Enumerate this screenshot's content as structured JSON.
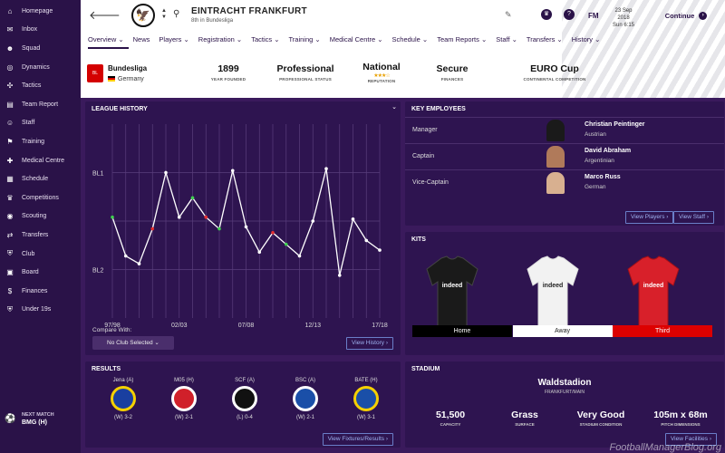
{
  "sidebar": {
    "items": [
      {
        "icon": "⌂",
        "label": "Homepage"
      },
      {
        "icon": "✉",
        "label": "Inbox"
      },
      {
        "icon": "☻",
        "label": "Squad"
      },
      {
        "icon": "◎",
        "label": "Dynamics"
      },
      {
        "icon": "✣",
        "label": "Tactics"
      },
      {
        "icon": "▤",
        "label": "Team Report"
      },
      {
        "icon": "☺",
        "label": "Staff"
      },
      {
        "icon": "⚑",
        "label": "Training"
      },
      {
        "icon": "✚",
        "label": "Medical Centre"
      },
      {
        "icon": "▦",
        "label": "Schedule"
      },
      {
        "icon": "♛",
        "label": "Competitions"
      },
      {
        "icon": "◉",
        "label": "Scouting"
      },
      {
        "icon": "⇄",
        "label": "Transfers"
      },
      {
        "icon": "⛨",
        "label": "Club"
      },
      {
        "icon": "▣",
        "label": "Board"
      },
      {
        "icon": "$",
        "label": "Finances"
      },
      {
        "icon": "⛨",
        "label": "Under 19s"
      }
    ],
    "next_match_label": "NEXT MATCH",
    "next_match_value": "BMG (H)"
  },
  "header": {
    "club_name": "EINTRACHT FRANKFURT",
    "club_sub": "8th in Bundesliga",
    "manager_initials": "FM",
    "date": "23 Sep 2018",
    "time": "Sun 6:15",
    "continue_label": "Continue"
  },
  "tabs": [
    "Overview",
    "News",
    "Players",
    "Registration",
    "Tactics",
    "Training",
    "Medical Centre",
    "Schedule",
    "Team Reports",
    "Staff",
    "Transfers",
    "History"
  ],
  "club_info": {
    "league": "Bundesliga",
    "country": "Germany",
    "bl_logo": "BL",
    "year_founded": "1899",
    "year_founded_label": "YEAR FOUNDED",
    "status": "Professional",
    "status_label": "PROFESSIONAL STATUS",
    "reputation": "National",
    "reputation_label": "REPUTATION",
    "reputation_stars": "★★★☆",
    "finances": "Secure",
    "finances_label": "FINANCES",
    "competition": "EURO Cup",
    "competition_label": "CONTINENTAL COMPETITION"
  },
  "league_history": {
    "title": "LEAGUE HISTORY",
    "compare_label": "Compare With:",
    "compare_value": "No Club Selected",
    "view_history": "View History"
  },
  "chart_data": {
    "type": "line",
    "x": [
      "97/98",
      "98/99",
      "99/00",
      "00/01",
      "01/02",
      "02/03",
      "03/04",
      "04/05",
      "05/06",
      "06/07",
      "07/08",
      "08/09",
      "09/10",
      "10/11",
      "11/12",
      "12/13",
      "13/14",
      "14/15",
      "15/16",
      "16/17",
      "17/18"
    ],
    "xticks": [
      "97/98",
      "02/03",
      "07/08",
      "12/13",
      "17/18"
    ],
    "yticks": [
      "BL1",
      "BL2"
    ],
    "values": [
      0.52,
      0.32,
      0.28,
      0.46,
      0.75,
      0.52,
      0.62,
      0.52,
      0.46,
      0.76,
      0.47,
      0.34,
      0.44,
      0.38,
      0.32,
      0.5,
      0.77,
      0.22,
      0.51,
      0.4,
      0.35
    ],
    "markers": {
      "green": [
        0,
        6,
        8,
        13
      ],
      "red": [
        3,
        7,
        12
      ]
    },
    "ylabel_note": ""
  },
  "key_employees": {
    "title": "KEY EMPLOYEES",
    "rows": [
      {
        "role": "Manager",
        "name": "Christian Peintinger",
        "nationality": "Austrian"
      },
      {
        "role": "Captain",
        "name": "David Abraham",
        "nationality": "Argentinian"
      },
      {
        "role": "Vice-Captain",
        "name": "Marco Russ",
        "nationality": "German"
      }
    ],
    "view_players": "View Players",
    "view_staff": "View Staff"
  },
  "kits": {
    "title": "KITS",
    "sponsor": "indeed",
    "labels": [
      "Home",
      "Away",
      "Third"
    ]
  },
  "results": {
    "title": "RESULTS",
    "view_label": "View Fixtures/Results",
    "items": [
      {
        "team": "Jena (A)",
        "score": "(W) 3-2",
        "color": "#1a3fa0",
        "accent": "#f5d000"
      },
      {
        "team": "M05 (H)",
        "score": "(W) 2-1",
        "color": "#d0202a",
        "accent": "#ffffff"
      },
      {
        "team": "SCF (A)",
        "score": "(L) 0-4",
        "color": "#111111",
        "accent": "#ffffff"
      },
      {
        "team": "BSC (A)",
        "score": "(W) 2-1",
        "color": "#1a4fa8",
        "accent": "#ffffff"
      },
      {
        "team": "BATE (H)",
        "score": "(W) 3-1",
        "color": "#1a4fa8",
        "accent": "#f5d000"
      }
    ]
  },
  "stadium": {
    "title": "STADIUM",
    "name": "Waldstadion",
    "city": "FRANKFURT/MAIN",
    "capacity": "51,500",
    "capacity_label": "CAPACITY",
    "surface": "Grass",
    "surface_label": "SURFACE",
    "condition": "Very Good",
    "condition_label": "STADIUM CONDITION",
    "dimensions": "105m x 68m",
    "dimensions_label": "PITCH DIMENSIONS",
    "view_facilities": "View Facilities"
  },
  "watermark": "FootballManagerBlog.org"
}
